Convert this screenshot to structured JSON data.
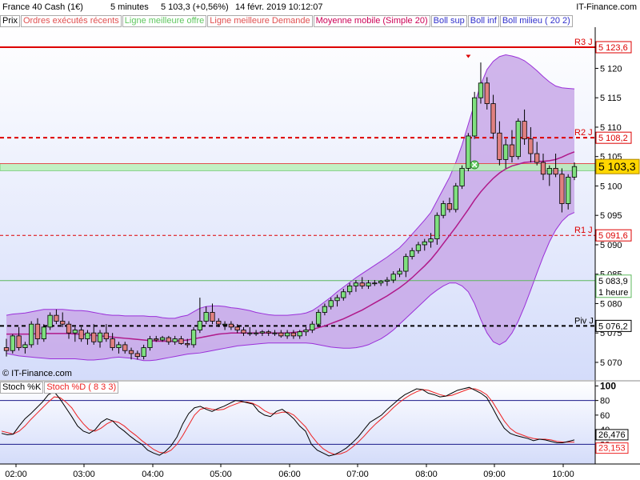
{
  "header": {
    "instrument": "France 40 Cash (1€)",
    "interval": "5 minutes",
    "quote": "5 103,3 (+0,56%)",
    "datetime": "14 févr. 2019 10:12:07",
    "source": "IT-Finance.com"
  },
  "legend": {
    "price": "Prix",
    "executed": "Ordres exécutés récents",
    "best_offer": "Ligne meilleure offre",
    "best_demand": "Ligne meilleure Demande",
    "ma": "Moyenne mobile (Simple 20)",
    "boll_sup": "Boll sup",
    "boll_inf": "Boll inf",
    "boll_mid": "Boll milieu ( 20 2)"
  },
  "watermark": "© IT-Finance.com",
  "stoch_legend": {
    "k": "Stoch %K",
    "d": "Stoch %D ( 8 3 3)"
  },
  "colors": {
    "bull": "#7fe07f",
    "bear": "#e08080",
    "band_fill": "#c8a8e8",
    "band_line": "#9b30d9",
    "ma": "#b0198a",
    "resistance": "#dd0000",
    "pivot": "#000000",
    "offer_zone": "#b8f0b8",
    "stoch_k": "#000000",
    "stoch_d": "#ee2222",
    "stoch_line": "#1a1a8a",
    "price_tag": "#ffd700"
  },
  "price_labels": {
    "r3": "R3 J",
    "r2": "R2 J",
    "r1": "R1 J",
    "piv": "Piv J",
    "r3_val": "5 123,6",
    "r2_val": "5 108,2",
    "r1_val": "5 091,6",
    "piv_val": "5 076,2",
    "current": "5 103,3",
    "hour_val": "5 083,9",
    "hour_label": "1 heure"
  },
  "chart_data": [
    {
      "type": "candlestick",
      "y_ticks": [
        "5 070",
        "5 075",
        "5 080",
        "5 085",
        "5 090",
        "5 095",
        "5 100",
        "5 105",
        "5 110",
        "5 115",
        "5 120"
      ],
      "ylim": [
        5067,
        5127
      ],
      "x_ticks": [
        "02:00",
        "03:00",
        "04:00",
        "05:00",
        "06:00",
        "07:00",
        "08:00",
        "09:00",
        "10:00"
      ],
      "levels": {
        "r3": 5123.6,
        "r2": 5108.2,
        "r1": 5091.6,
        "pivot": 5076.2,
        "current": 5103.3,
        "hour": 5083.9
      },
      "candles": [
        [
          5072.5,
          5074.0,
          5071.0,
          5072.0
        ],
        [
          5072.0,
          5074.8,
          5071.5,
          5074.5
        ],
        [
          5074.5,
          5076.0,
          5072.0,
          5072.5
        ],
        [
          5072.5,
          5073.5,
          5071.5,
          5073.0
        ],
        [
          5073.0,
          5077.0,
          5072.5,
          5076.5
        ],
        [
          5076.5,
          5077.5,
          5073.0,
          5074.0
        ],
        [
          5074.0,
          5076.5,
          5073.5,
          5076.0
        ],
        [
          5076.0,
          5078.5,
          5075.5,
          5078.0
        ],
        [
          5078.0,
          5079.0,
          5076.5,
          5077.0
        ],
        [
          5077.0,
          5078.5,
          5076.0,
          5076.5
        ],
        [
          5076.5,
          5077.0,
          5074.0,
          5075.0
        ],
        [
          5075.0,
          5076.0,
          5073.5,
          5075.5
        ],
        [
          5075.5,
          5076.0,
          5073.5,
          5074.0
        ],
        [
          5074.0,
          5075.5,
          5073.0,
          5075.0
        ],
        [
          5075.0,
          5076.5,
          5073.0,
          5073.5
        ],
        [
          5073.5,
          5075.5,
          5072.5,
          5075.0
        ],
        [
          5075.0,
          5076.5,
          5073.5,
          5074.0
        ],
        [
          5074.0,
          5075.0,
          5072.0,
          5072.5
        ],
        [
          5072.5,
          5073.5,
          5071.5,
          5073.0
        ],
        [
          5073.0,
          5073.5,
          5071.5,
          5072.0
        ],
        [
          5072.0,
          5072.5,
          5070.5,
          5071.5
        ],
        [
          5071.5,
          5072.0,
          5070.5,
          5071.0
        ],
        [
          5071.0,
          5073.0,
          5070.5,
          5072.5
        ],
        [
          5072.5,
          5074.5,
          5072.0,
          5074.0
        ],
        [
          5074.0,
          5074.5,
          5073.5,
          5073.8
        ],
        [
          5073.8,
          5074.5,
          5073.5,
          5074.2
        ],
        [
          5074.2,
          5074.5,
          5073.0,
          5073.5
        ],
        [
          5073.5,
          5074.5,
          5073.0,
          5074.0
        ],
        [
          5074.0,
          5074.5,
          5073.0,
          5073.2
        ],
        [
          5073.2,
          5074.0,
          5072.5,
          5073.0
        ],
        [
          5073.0,
          5076.0,
          5072.5,
          5075.5
        ],
        [
          5075.5,
          5081.0,
          5075.0,
          5077.0
        ],
        [
          5077.0,
          5079.5,
          5076.5,
          5078.5
        ],
        [
          5078.5,
          5080.0,
          5076.5,
          5077.0
        ],
        [
          5077.0,
          5077.5,
          5076.0,
          5076.5
        ],
        [
          5076.5,
          5077.0,
          5075.5,
          5076.5
        ],
        [
          5076.5,
          5077.0,
          5075.5,
          5076.0
        ],
        [
          5076.0,
          5076.5,
          5075.0,
          5075.5
        ],
        [
          5075.5,
          5076.0,
          5074.5,
          5075.0
        ],
        [
          5075.0,
          5076.0,
          5074.5,
          5075.0
        ],
        [
          5075.0,
          5075.5,
          5074.5,
          5075.0
        ],
        [
          5075.0,
          5075.5,
          5074.5,
          5075.2
        ],
        [
          5075.2,
          5075.5,
          5074.5,
          5075.0
        ],
        [
          5075.0,
          5075.5,
          5074.5,
          5075.0
        ],
        [
          5075.0,
          5075.5,
          5074.2,
          5074.5
        ],
        [
          5074.5,
          5075.5,
          5074.0,
          5075.0
        ],
        [
          5075.0,
          5075.5,
          5074.0,
          5074.5
        ],
        [
          5074.5,
          5075.5,
          5074.0,
          5075.2
        ],
        [
          5075.2,
          5076.0,
          5074.5,
          5075.5
        ],
        [
          5075.5,
          5077.0,
          5075.0,
          5076.5
        ],
        [
          5076.5,
          5079.0,
          5076.0,
          5078.5
        ],
        [
          5078.5,
          5080.0,
          5078.0,
          5079.5
        ],
        [
          5079.5,
          5081.0,
          5079.0,
          5080.5
        ],
        [
          5080.5,
          5081.5,
          5079.5,
          5081.0
        ],
        [
          5081.0,
          5082.5,
          5080.5,
          5082.0
        ],
        [
          5082.0,
          5083.5,
          5081.5,
          5083.0
        ],
        [
          5083.0,
          5084.0,
          5082.0,
          5083.5
        ],
        [
          5083.5,
          5084.5,
          5082.5,
          5083.0
        ],
        [
          5083.0,
          5084.0,
          5082.5,
          5083.5
        ],
        [
          5083.5,
          5084.0,
          5083.0,
          5083.5
        ],
        [
          5083.5,
          5084.0,
          5083.0,
          5083.8
        ],
        [
          5083.8,
          5084.5,
          5083.0,
          5084.0
        ],
        [
          5084.0,
          5085.5,
          5083.5,
          5085.0
        ],
        [
          5085.0,
          5086.0,
          5084.5,
          5085.5
        ],
        [
          5085.5,
          5088.5,
          5084.5,
          5088.0
        ],
        [
          5088.0,
          5089.5,
          5087.5,
          5089.0
        ],
        [
          5089.0,
          5090.5,
          5088.5,
          5090.0
        ],
        [
          5090.0,
          5091.0,
          5089.0,
          5090.5
        ],
        [
          5090.5,
          5092.0,
          5089.5,
          5091.0
        ],
        [
          5091.0,
          5095.5,
          5090.0,
          5095.0
        ],
        [
          5095.0,
          5097.5,
          5094.5,
          5097.0
        ],
        [
          5097.0,
          5098.0,
          5095.5,
          5096.0
        ],
        [
          5096.0,
          5100.5,
          5095.5,
          5100.0
        ],
        [
          5100.0,
          5103.5,
          5099.5,
          5103.0
        ],
        [
          5103.0,
          5109.0,
          5102.5,
          5108.5
        ],
        [
          5108.5,
          5116.0,
          5108.0,
          5115.0
        ],
        [
          5115.0,
          5121.0,
          5114.0,
          5117.5
        ],
        [
          5117.5,
          5118.5,
          5113.0,
          5114.0
        ],
        [
          5114.0,
          5115.5,
          5108.0,
          5109.0
        ],
        [
          5109.0,
          5111.0,
          5103.5,
          5104.5
        ],
        [
          5104.5,
          5108.0,
          5103.0,
          5107.0
        ],
        [
          5107.0,
          5109.5,
          5104.0,
          5105.0
        ],
        [
          5105.0,
          5111.5,
          5104.5,
          5111.0
        ],
        [
          5111.0,
          5113.0,
          5107.0,
          5108.0
        ],
        [
          5108.0,
          5110.0,
          5104.0,
          5105.5
        ],
        [
          5105.5,
          5107.5,
          5103.5,
          5104.0
        ],
        [
          5104.0,
          5105.5,
          5101.0,
          5102.0
        ],
        [
          5102.0,
          5103.5,
          5100.0,
          5103.0
        ],
        [
          5103.0,
          5105.5,
          5101.5,
          5102.0
        ],
        [
          5102.0,
          5103.0,
          5095.5,
          5097.0
        ],
        [
          5097.0,
          5102.0,
          5096.0,
          5101.5
        ],
        [
          5101.5,
          5104.0,
          5101.0,
          5103.3
        ]
      ],
      "boll_upper": [
        5078,
        5078.2,
        5078.3,
        5078.4,
        5078.6,
        5078.8,
        5079,
        5079,
        5079,
        5079,
        5078.9,
        5078.8,
        5078.8,
        5078.7,
        5078.5,
        5078.3,
        5078.1,
        5078,
        5078,
        5077.9,
        5077.9,
        5077.9,
        5077.9,
        5077.8,
        5077.8,
        5077.6,
        5077.5,
        5077.5,
        5077.8,
        5078,
        5078.6,
        5079.2,
        5079.5,
        5079.6,
        5079.6,
        5079.5,
        5079.3,
        5079.2,
        5079,
        5078.8,
        5078.5,
        5078.3,
        5078.1,
        5078,
        5078,
        5078,
        5078.1,
        5078.2,
        5078.4,
        5078.8,
        5079.5,
        5080.3,
        5081.1,
        5082,
        5082.8,
        5083.6,
        5084.4,
        5085.1,
        5085.8,
        5086.5,
        5087.2,
        5087.9,
        5088.7,
        5089.5,
        5090.6,
        5091.8,
        5093,
        5094.2,
        5095.5,
        5097.5,
        5099.5,
        5101.5,
        5104,
        5107,
        5110.5,
        5114,
        5117.2,
        5119.8,
        5121.2,
        5122,
        5122.3,
        5122.1,
        5121.8,
        5121.3,
        5120.5,
        5119.6,
        5118.6,
        5117.7,
        5117,
        5116.7,
        5116.6,
        5116.5
      ],
      "boll_lower": [
        5071.5,
        5071.3,
        5071.1,
        5071,
        5070.9,
        5070.8,
        5070.7,
        5070.6,
        5070.6,
        5070.6,
        5070.6,
        5070.6,
        5070.5,
        5070.4,
        5070.4,
        5070.5,
        5070.6,
        5070.8,
        5070.9,
        5070.8,
        5070.7,
        5070.5,
        5070.3,
        5070.3,
        5070.4,
        5070.6,
        5070.8,
        5071,
        5071.2,
        5071.4,
        5071.5,
        5071.6,
        5071.8,
        5072,
        5072.2,
        5072.4,
        5072.6,
        5072.8,
        5072.9,
        5073,
        5073.1,
        5073.2,
        5073.3,
        5073.3,
        5073.3,
        5073.3,
        5073.3,
        5073.3,
        5073.3,
        5073.2,
        5073,
        5072.8,
        5072.6,
        5072.5,
        5072.4,
        5072.4,
        5072.5,
        5072.7,
        5073,
        5073.5,
        5074,
        5074.7,
        5075.5,
        5076.5,
        5077.5,
        5078.5,
        5079.5,
        5080.5,
        5081.5,
        5082.3,
        5083,
        5083.5,
        5083.5,
        5083,
        5082,
        5080,
        5077.3,
        5075,
        5073.5,
        5073,
        5073.6,
        5075,
        5077,
        5079.5,
        5082.3,
        5085.2,
        5088,
        5090.5,
        5092.5,
        5094,
        5095,
        5095.5
      ],
      "ma": [
        5074.8,
        5074.8,
        5074.8,
        5074.8,
        5074.8,
        5074.9,
        5074.9,
        5074.9,
        5074.9,
        5074.9,
        5074.9,
        5074.8,
        5074.8,
        5074.7,
        5074.6,
        5074.5,
        5074.4,
        5074.3,
        5074.2,
        5074.1,
        5074,
        5073.9,
        5073.8,
        5073.7,
        5073.6,
        5073.6,
        5073.6,
        5073.6,
        5073.7,
        5073.8,
        5074,
        5074.2,
        5074.4,
        5074.6,
        5074.8,
        5074.9,
        5075,
        5075,
        5075,
        5075,
        5075,
        5075,
        5075,
        5075,
        5075,
        5075,
        5075.1,
        5075.2,
        5075.4,
        5075.6,
        5075.9,
        5076.2,
        5076.6,
        5077,
        5077.4,
        5077.9,
        5078.4,
        5078.9,
        5079.5,
        5080.1,
        5080.7,
        5081.3,
        5082,
        5082.7,
        5083.5,
        5084.4,
        5085.4,
        5086.4,
        5087.5,
        5088.8,
        5090.2,
        5091.6,
        5093,
        5094.5,
        5096,
        5097.6,
        5099,
        5100.2,
        5101.3,
        5102.2,
        5102.9,
        5103.4,
        5103.7,
        5104,
        5104.1,
        5104.2,
        5104.2,
        5104.3,
        5104.5,
        5104.9,
        5105.4,
        5105.8
      ]
    },
    {
      "type": "line",
      "y_ticks": [
        "20",
        "40",
        "60",
        "80",
        "100"
      ],
      "ylim": [
        -7,
        107
      ],
      "levels": [
        20,
        80
      ],
      "last_k": "26,476",
      "last_d": "23,153",
      "series": [
        {
          "name": "Stoch %K",
          "values": [
            35,
            33,
            34,
            45,
            55,
            62,
            70,
            78,
            88,
            92,
            82,
            70,
            58,
            45,
            38,
            35,
            40,
            50,
            55,
            52,
            44,
            38,
            31,
            25,
            20,
            12,
            8,
            5,
            10,
            18,
            30,
            48,
            62,
            70,
            72,
            68,
            65,
            69,
            72,
            76,
            80,
            79,
            77,
            75,
            65,
            60,
            58,
            65,
            68,
            62,
            55,
            45,
            38,
            20,
            12,
            8,
            4,
            6,
            10,
            15,
            22,
            30,
            40,
            50,
            55,
            60,
            68,
            75,
            82,
            88,
            92,
            96,
            95,
            90,
            88,
            85,
            86,
            90,
            94,
            96,
            98,
            94,
            90,
            84,
            70,
            55,
            42,
            35,
            32,
            30,
            28,
            25,
            27,
            26,
            24,
            22,
            22,
            24,
            26
          ]
        },
        {
          "name": "Stoch %D ( 8 3 3)",
          "values": [
            38,
            36,
            34,
            38,
            45,
            54,
            62,
            70,
            78,
            85,
            84,
            78,
            70,
            58,
            48,
            40,
            38,
            42,
            48,
            52,
            50,
            45,
            38,
            32,
            25,
            19,
            13,
            9,
            8,
            12,
            20,
            32,
            46,
            60,
            68,
            70,
            68,
            67,
            68,
            72,
            75,
            78,
            78,
            76,
            72,
            66,
            62,
            62,
            64,
            64,
            60,
            52,
            44,
            32,
            22,
            14,
            9,
            6,
            7,
            10,
            16,
            23,
            31,
            40,
            48,
            55,
            62,
            70,
            77,
            83,
            88,
            92,
            95,
            94,
            91,
            88,
            86,
            87,
            90,
            93,
            96,
            96,
            93,
            88,
            78,
            65,
            52,
            42,
            36,
            33,
            30,
            28,
            27,
            27,
            26,
            24,
            23,
            23,
            23
          ]
        }
      ]
    }
  ]
}
